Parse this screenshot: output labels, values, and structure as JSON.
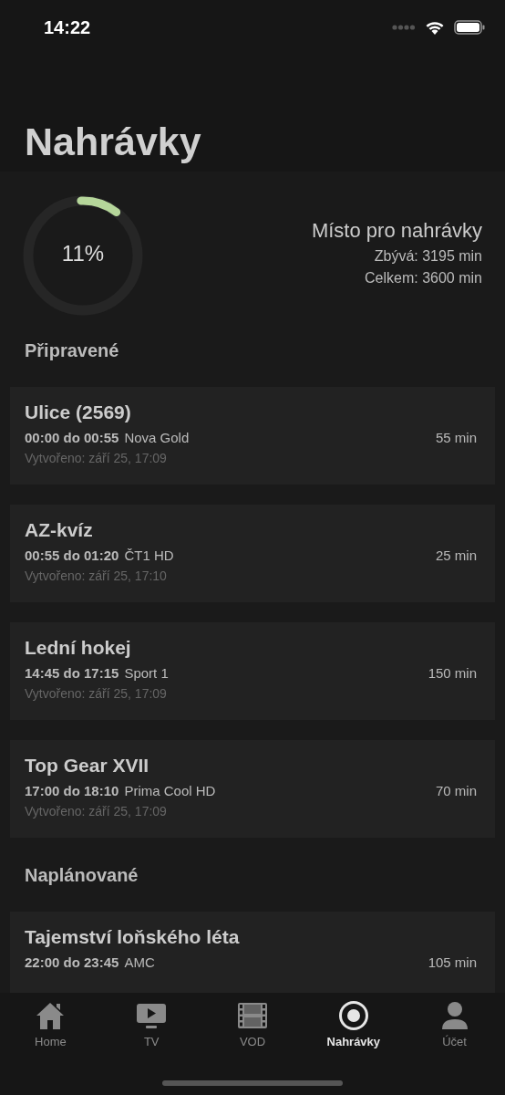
{
  "status_bar": {
    "time": "14:22"
  },
  "title": "Nahrávky",
  "storage": {
    "percent": "11%",
    "level": 0.11,
    "heading": "Místo pro nahrávky",
    "remaining": "Zbývá: 3195 min",
    "total": "Celkem: 3600 min"
  },
  "sections": [
    {
      "title": "Připravené",
      "recordings": [
        {
          "title": "Ulice (2569)",
          "time": "00:00 do 00:55",
          "channel": "Nova Gold",
          "duration": "55 min",
          "created": "Vytvořeno: září 25, 17:09"
        },
        {
          "title": "AZ-kvíz",
          "time": "00:55 do 01:20",
          "channel": "ČT1 HD",
          "duration": "25 min",
          "created": "Vytvořeno: září 25, 17:10"
        },
        {
          "title": "Lední hokej",
          "time": "14:45 do 17:15",
          "channel": "Sport 1",
          "duration": "150 min",
          "created": "Vytvořeno: září 25, 17:09"
        },
        {
          "title": "Top Gear XVII",
          "time": "17:00 do 18:10",
          "channel": "Prima Cool HD",
          "duration": "70 min",
          "created": "Vytvořeno: září 25, 17:09"
        }
      ]
    },
    {
      "title": "Naplánované",
      "recordings": [
        {
          "title": "Tajemství loňského léta",
          "time": "22:00 do 23:45",
          "channel": "AMC",
          "duration": "105 min"
        }
      ]
    }
  ],
  "tab_bar": [
    {
      "kind": "home",
      "label": "Home",
      "selected": false
    },
    {
      "kind": "tv",
      "label": "TV",
      "selected": false
    },
    {
      "kind": "vod",
      "label": "VOD",
      "selected": false
    },
    {
      "kind": "recordings",
      "label": "Nahrávky",
      "selected": true
    },
    {
      "kind": "account",
      "label": "Účet",
      "selected": false
    }
  ]
}
